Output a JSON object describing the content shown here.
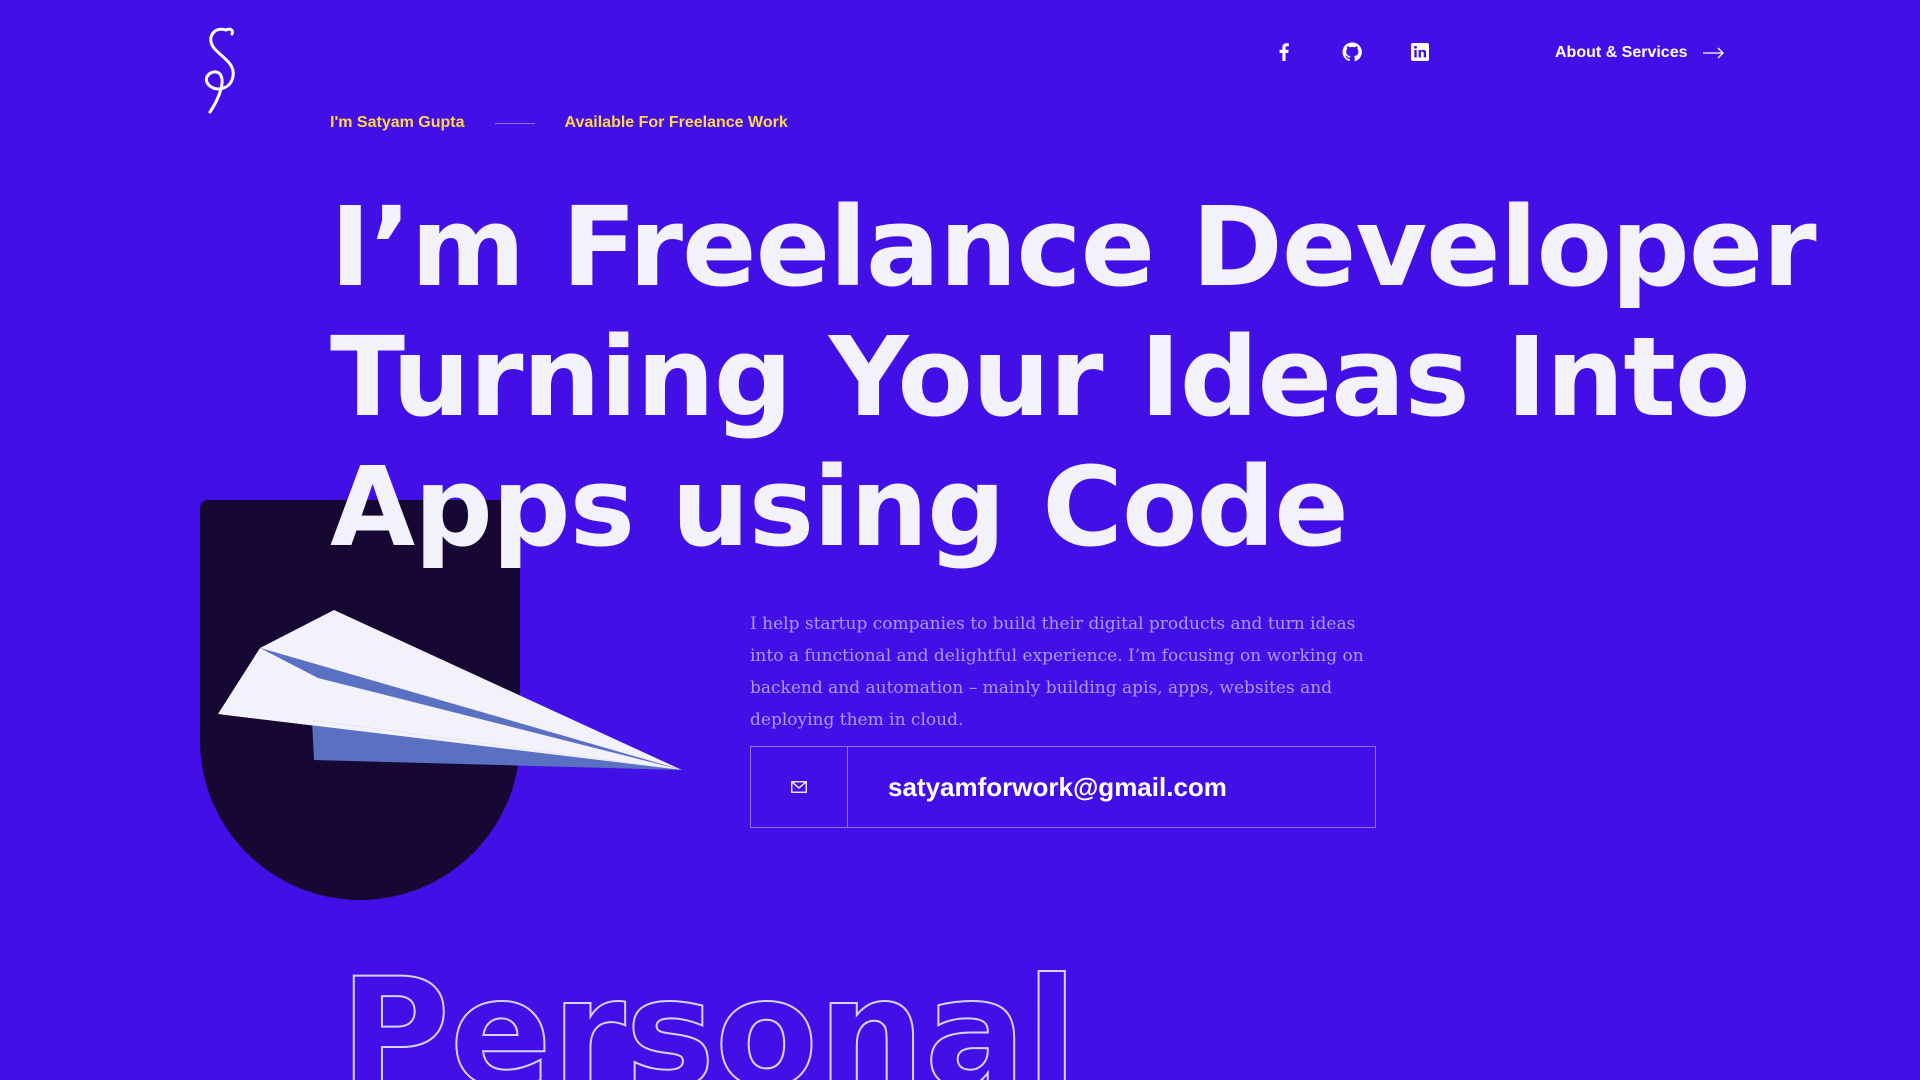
{
  "brand": {
    "logo_icon": "signature-s-logo"
  },
  "social": [
    {
      "name": "facebook",
      "icon": "facebook-icon"
    },
    {
      "name": "github",
      "icon": "github-icon"
    },
    {
      "name": "linkedin",
      "icon": "linkedin-icon"
    }
  ],
  "nav": {
    "about_label": "About & Services",
    "arrow_icon": "arrow-right-icon"
  },
  "intro": {
    "name": "I'm Satyam Gupta",
    "availability": "Available For Freelance Work"
  },
  "hero": {
    "line1": "I’m Freelance Developer",
    "line2": "Turning Your Ideas Into",
    "line3": "Apps using Code",
    "description": "I help startup companies to build their digital products and turn ideas into a functional and delightful experience. I’m focusing on working on backend and automation – mainly building apis, apps, websites and deploying them in cloud.",
    "illustration": "paper-plane-icon"
  },
  "contact": {
    "email": "satyamforwork@gmail.com",
    "icon": "mail-icon"
  },
  "section": {
    "outline_title": "Personal"
  },
  "colors": {
    "background": "#4210e6",
    "accent": "#ffd64a",
    "shield": "#170733",
    "text": "#f3f1fa",
    "muted_text": "#a99bf4"
  }
}
